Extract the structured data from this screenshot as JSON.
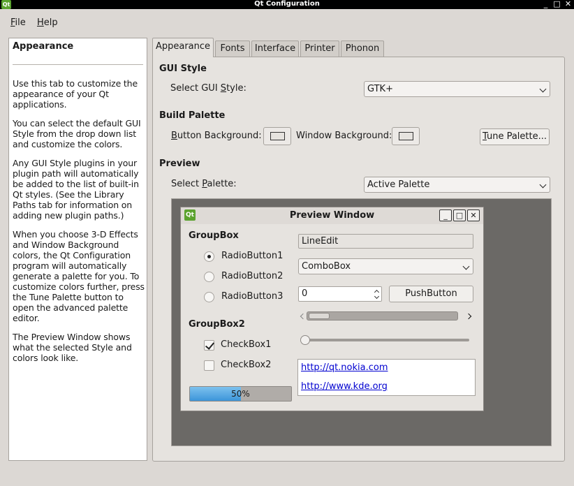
{
  "window": {
    "title": "Qt Configuration",
    "buttons": [
      "_",
      "□",
      "✕"
    ]
  },
  "menu": {
    "file_first": "F",
    "file_rest": "ile",
    "help_first": "H",
    "help_rest": "elp"
  },
  "help_panel": {
    "title": "Appearance",
    "paragraphs": [
      "Use this tab to customize the appearance of your Qt applications.",
      "You can select the default GUI Style from the drop down list and customize the colors.",
      "Any GUI Style plugins in your plugin path will automatically be added to the list of built-in Qt styles. (See the Library Paths tab for information on adding new plugin paths.)",
      "When you choose 3-D Effects and Window Background colors, the Qt Configuration program will automatically generate a palette for you. To customize colors further, press the Tune Palette button to open the advanced palette editor.",
      "The Preview Window shows what the selected Style and colors look like."
    ]
  },
  "tabs": [
    "Appearance",
    "Fonts",
    "Interface",
    "Printer",
    "Phonon"
  ],
  "active_tab": "Appearance",
  "gui_style": {
    "section": "GUI Style",
    "label_pre": "Select GUI ",
    "label_u": "S",
    "label_post": "tyle:",
    "value": "GTK+"
  },
  "build_palette": {
    "section": "Build Palette",
    "button_bg_u": "B",
    "button_bg_rest": "utton Background:",
    "window_bg_pre": "Window Back",
    "window_bg_u": "g",
    "window_bg_post": "round:",
    "tune_u": "T",
    "tune_rest": "une Palette..."
  },
  "preview": {
    "section": "Preview",
    "label_pre": "Select ",
    "label_u": "P",
    "label_post": "alette:",
    "value": "Active Palette"
  },
  "preview_window": {
    "title": "Preview Window",
    "icon_text": "Qt",
    "groupbox1": "GroupBox",
    "radio1": "RadioButton1",
    "radio2": "RadioButton2",
    "radio3": "RadioButton3",
    "groupbox2": "GroupBox2",
    "check1": "CheckBox1",
    "check2": "CheckBox2",
    "lineedit": "LineEdit",
    "combobox": "ComboBox",
    "spin_value": "0",
    "pushbutton": "PushButton",
    "link1": "http://qt.nokia.com",
    "link2": "http://www.kde.org",
    "progress_text": "50%",
    "progress_value": 0.5
  }
}
